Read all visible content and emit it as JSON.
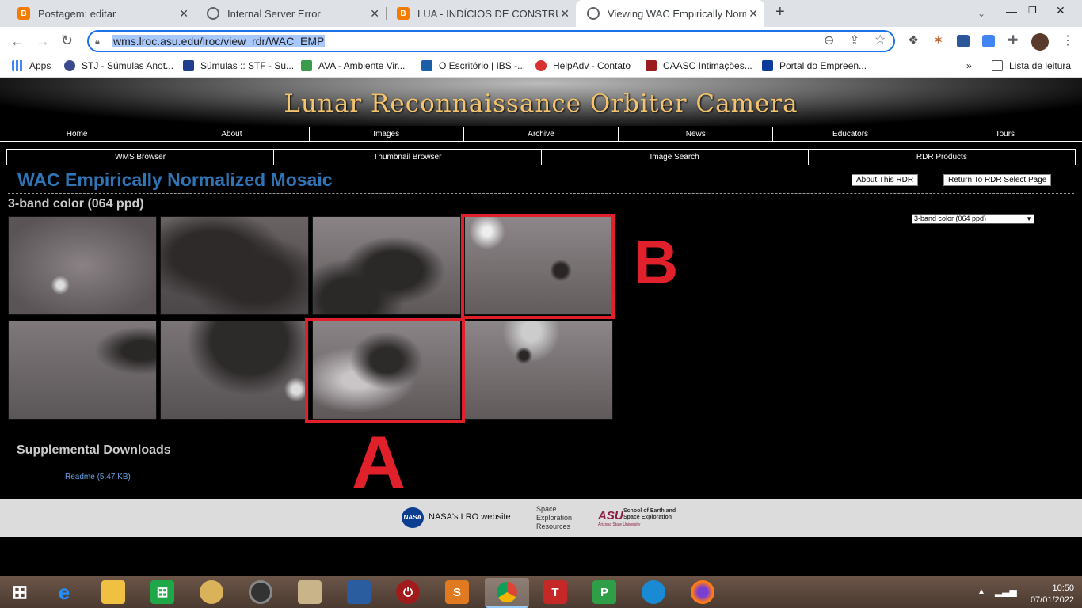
{
  "browser": {
    "tabs": [
      {
        "title": "Postagem: editar",
        "icon": "blogger-icon",
        "color": "#f57c00"
      },
      {
        "title": "Internal Server Error",
        "icon": "globe-icon",
        "color": "#5f6368"
      },
      {
        "title": "LUA - INDÍCIOS DE CONSTRUÇÕES",
        "icon": "blogger-icon",
        "color": "#f57c00"
      },
      {
        "title": "Viewing WAC Empirically Normalized",
        "icon": "globe-icon",
        "color": "#5f6368",
        "active": true
      }
    ],
    "url": "wms.lroc.asu.edu/lroc/view_rdr/WAC_EMP",
    "bookmarks": [
      {
        "label": "Apps",
        "color": "#4285f4"
      },
      {
        "label": "STJ - Súmulas Anot...",
        "color": "#3b4a8a"
      },
      {
        "label": "Súmulas :: STF - Su...",
        "color": "#1f3f8f"
      },
      {
        "label": "AVA - Ambiente Vir...",
        "color": "#3a9b4a"
      },
      {
        "label": "O Escritório | IBS -...",
        "color": "#1b5fa8"
      },
      {
        "label": "HelpAdv - Contato",
        "color": "#d93030"
      },
      {
        "label": "CAASC Intimações...",
        "color": "#9a1c1c"
      },
      {
        "label": "Portal do Empreen...",
        "color": "#0b3c9c"
      }
    ],
    "reading_list": "Lista de leitura",
    "more": "»"
  },
  "site": {
    "banner_title": "Lunar Reconnaissance Orbiter Camera",
    "nav1": [
      "Home",
      "About",
      "Images",
      "Archive",
      "News",
      "Educators",
      "Tours"
    ],
    "nav2": [
      "WMS Browser",
      "Thumbnail Browser",
      "Image Search",
      "RDR Products"
    ],
    "page_title": "WAC Empirically Normalized Mosaic",
    "about_btn": "About This RDR",
    "return_btn": "Return To RDR Select Page",
    "subtitle": "3-band color (064 ppd)",
    "select_value": "3-band color (064 ppd)",
    "supp_title": "Supplemental Downloads",
    "readme": "Readme (5.47 KB)",
    "annotation_a": "A",
    "annotation_b": "B",
    "footer": {
      "nasa_logo": "NASA",
      "nasa_link": "NASA's LRO website",
      "ser_1": "Space",
      "ser_2": "Exploration",
      "ser_3": "Resources",
      "asu_logo": "ASU",
      "asu_1": "School of Earth and",
      "asu_2": "Space Exploration",
      "asu_3": "Arizona State University"
    }
  },
  "taskbar": {
    "time": "10:50",
    "date": "07/01/2022"
  }
}
